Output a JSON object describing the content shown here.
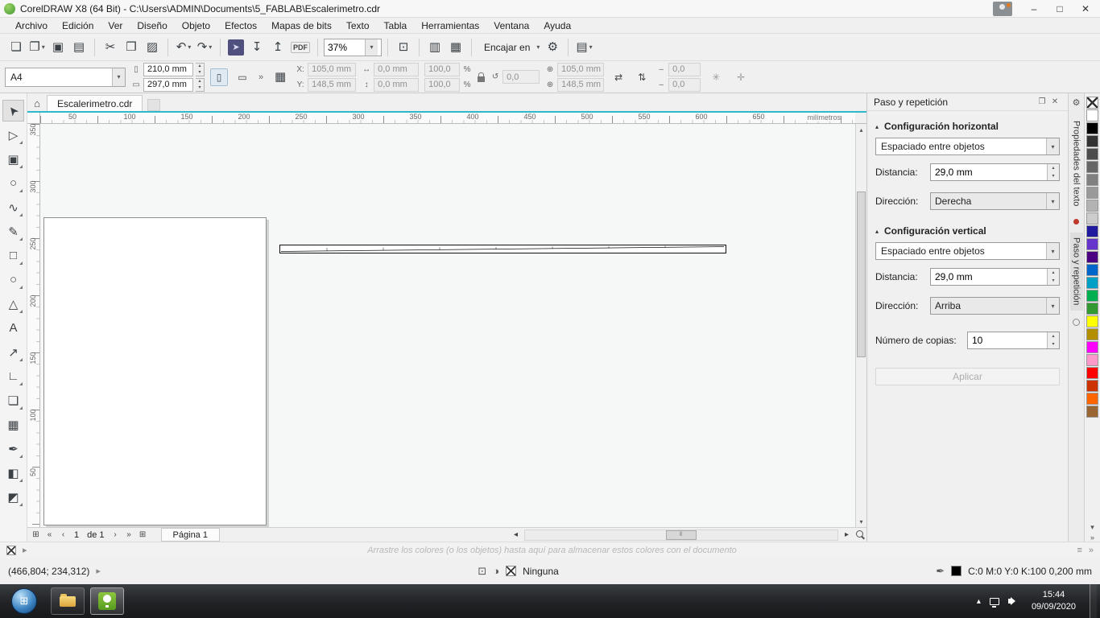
{
  "colors": {
    "accent": "#2eb8cb",
    "swatch_black": "#000000"
  },
  "window": {
    "title": "CorelDRAW X8 (64 Bit) - C:\\Users\\ADMIN\\Documents\\5_FABLAB\\Escalerimetro.cdr"
  },
  "icons": {
    "home": "⌂",
    "new_doc": "❏",
    "open": "❐",
    "save": "▣",
    "print": "▤",
    "cut": "✂",
    "copy": "❒",
    "paste": "▨",
    "undo": "↶",
    "redo": "↷",
    "welcome": "➤",
    "import": "↧",
    "export": "↥",
    "fullscreen": "⊡",
    "ruler_toggle": "▥",
    "grid_toggle": "▦",
    "gear": "⚙",
    "layout": "▤",
    "caret": "▾",
    "chevron": "»",
    "minimize": "–",
    "maximize": "□",
    "close": "✕",
    "spin_up": "▴",
    "spin_down": "▾",
    "left": "◂",
    "right": "▸",
    "up": "▴",
    "down": "▾",
    "nav_first": "«",
    "nav_prev": "‹",
    "nav_next": "›",
    "nav_last": "»",
    "add_page": "⊞",
    "collapse": "▴",
    "portrait": "▯",
    "landscape": "▭",
    "grid9": "▦",
    "dim_h": "↔",
    "dim_v": "↕",
    "percent": "%",
    "rotate": "↺",
    "mirror_h": "⇄",
    "mirror_v": "⇅",
    "center": "⊕",
    "dash": "–",
    "star": "✳",
    "target": "✛",
    "pen": "✒",
    "monitor": "⊡",
    "wheel": "◑",
    "menu": "≡",
    "float": "❐",
    "tray_up": "▴"
  },
  "menu": {
    "items": [
      "Archivo",
      "Edición",
      "Ver",
      "Diseño",
      "Objeto",
      "Efectos",
      "Mapas de bits",
      "Texto",
      "Tabla",
      "Herramientas",
      "Ventana",
      "Ayuda"
    ]
  },
  "toolbar": {
    "zoom_value": "37%",
    "pdf_label": "PDF",
    "snap_label": "Encajar en"
  },
  "property_bar": {
    "preset": "A4",
    "page_width": "210,0 mm",
    "page_height": "297,0 mm",
    "x_label": "X:",
    "y_label": "Y:",
    "x_value": "105,0 mm",
    "y_value": "148,5 mm",
    "width_value": "0,0 mm",
    "height_value": "0,0 mm",
    "scale_h": "100,0",
    "scale_v": "100,0",
    "angle_value": "0,0",
    "center_x": "105,0 mm",
    "center_y": "148,5 mm",
    "outline_top": "0,0",
    "outline_bottom": "0,0"
  },
  "tabs": {
    "active": "Escalerimetro.cdr"
  },
  "ruler": {
    "h_labels": [
      "50",
      "100",
      "150",
      "200",
      "250",
      "300",
      "350",
      "400",
      "450",
      "500",
      "550",
      "600",
      "650"
    ],
    "v_labels": [
      "350",
      "300",
      "250",
      "200",
      "150",
      "100",
      "50"
    ],
    "units": "milímetros"
  },
  "toolbox": {
    "tools": [
      {
        "id": "pick-tool",
        "glyph": "➤"
      },
      {
        "id": "shape-tool",
        "glyph": "▷"
      },
      {
        "id": "crop-tool",
        "glyph": "▣"
      },
      {
        "id": "zoom-tool",
        "glyph": "○"
      },
      {
        "id": "freehand-tool",
        "glyph": "∿"
      },
      {
        "id": "artistic-media-tool",
        "glyph": "✎"
      },
      {
        "id": "rectangle-tool",
        "glyph": "□"
      },
      {
        "id": "ellipse-tool",
        "glyph": "○"
      },
      {
        "id": "polygon-tool",
        "glyph": "△"
      },
      {
        "id": "text-tool",
        "glyph": "A"
      },
      {
        "id": "dimension-tool",
        "glyph": "↗"
      },
      {
        "id": "connector-tool",
        "glyph": "∟"
      },
      {
        "id": "drop-shadow-tool",
        "glyph": "❏"
      },
      {
        "id": "transparency-tool",
        "glyph": "▦"
      },
      {
        "id": "eyedropper-tool",
        "glyph": "✒"
      },
      {
        "id": "interactive-fill-tool",
        "glyph": "◧"
      },
      {
        "id": "smart-fill-tool",
        "glyph": "◩"
      }
    ]
  },
  "docker": {
    "title": "Paso y repetición",
    "section_horizontal": "Configuración horizontal",
    "spacing_mode_h": "Espaciado entre objetos",
    "distance_label": "Distancia:",
    "distance_h": "29,0 mm",
    "direction_label": "Dirección:",
    "direction_h": "Derecha",
    "section_vertical": "Configuración vertical",
    "spacing_mode_v": "Espaciado entre objetos",
    "distance_v": "29,0 mm",
    "direction_v": "Arriba",
    "copies_label": "Número de copias:",
    "copies_value": "10",
    "apply_label": "Aplicar"
  },
  "docker_tabs": {
    "properties_text": "Propiedades del texto",
    "step_repeat": "Paso y repetición"
  },
  "palette": {
    "colors": [
      "#FFFFFF",
      "#000000",
      "#333333",
      "#4D4D4D",
      "#666666",
      "#808080",
      "#999999",
      "#B3B3B3",
      "#CCCCCC",
      "#1F1A9E",
      "#6633CC",
      "#4B0082",
      "#0066CC",
      "#00A0C6",
      "#00B050",
      "#339933",
      "#FFFF00",
      "#B38F00",
      "#FF00FF",
      "#FF99CC",
      "#FF0000",
      "#CC3300",
      "#FF6600",
      "#996633"
    ]
  },
  "page_nav": {
    "current": "1",
    "of": "de 1",
    "page_tab": "Página 1"
  },
  "doc_palette": {
    "hint": "Arrastre los colores (o los objetos) hasta aquí para almacenar estos colores con el documento"
  },
  "status_bar": {
    "coords": "(466,804; 234,312)",
    "fill_label": "Ninguna",
    "outline_label": "C:0 M:0 Y:0 K:100  0,200 mm"
  },
  "taskbar": {
    "time": "15:44",
    "date": "09/09/2020"
  }
}
